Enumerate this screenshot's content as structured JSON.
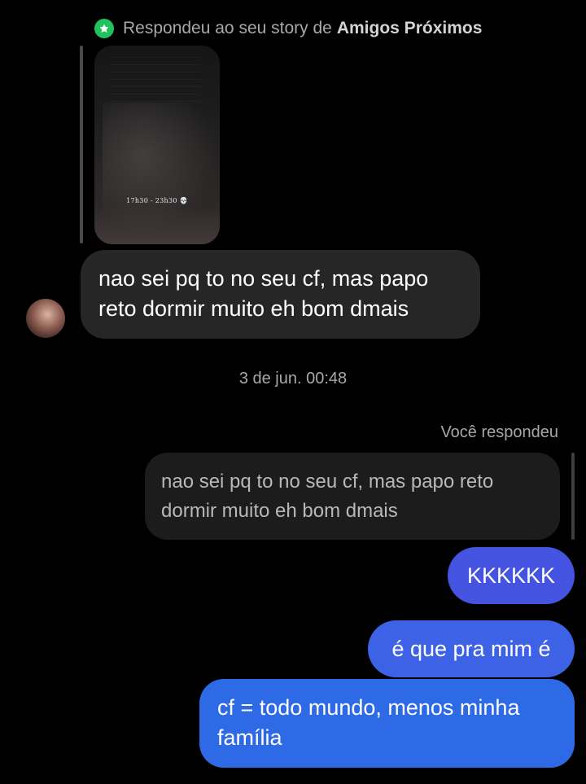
{
  "story_reply": {
    "prefix": "Respondeu ao seu story de",
    "list_name": "Amigos Próximos",
    "thumbnail_caption": "17h30 - 23h30 💀"
  },
  "incoming_message": {
    "text": "nao sei pq to no seu cf, mas papo reto dormir muito eh bom dmais"
  },
  "timestamp": "3 de jun. 00:48",
  "reply_label": "Você respondeu",
  "quoted_message": "nao sei pq to no seu cf, mas papo reto dormir muito eh bom dmais",
  "outgoing_messages": [
    {
      "text": "KKKKKK"
    },
    {
      "text": "é que pra mim é"
    },
    {
      "text": "cf = todo mundo, menos minha família"
    }
  ],
  "colors": {
    "background": "#000000",
    "incoming_bubble": "#262626",
    "outgoing_bubble_top": "#4554e0",
    "outgoing_bubble_bottom": "#2f6ae6",
    "close_friends_badge": "#1fc25b"
  }
}
